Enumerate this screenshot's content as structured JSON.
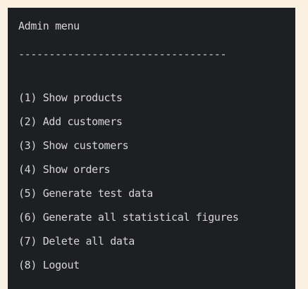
{
  "console": {
    "title": "Admin menu",
    "separator": "----------------------------------",
    "menu_items": [
      "(1) Show products",
      "(2) Add customers",
      "(3) Show customers",
      "(4) Show orders",
      "(5) Generate test data",
      "(6) Generate all statistical figures",
      "(7) Delete all data",
      "(8) Logout"
    ]
  },
  "colors": {
    "page_background": "#fbf1e3",
    "console_background": "#1e1f22",
    "console_text": "#d6d6d6"
  }
}
